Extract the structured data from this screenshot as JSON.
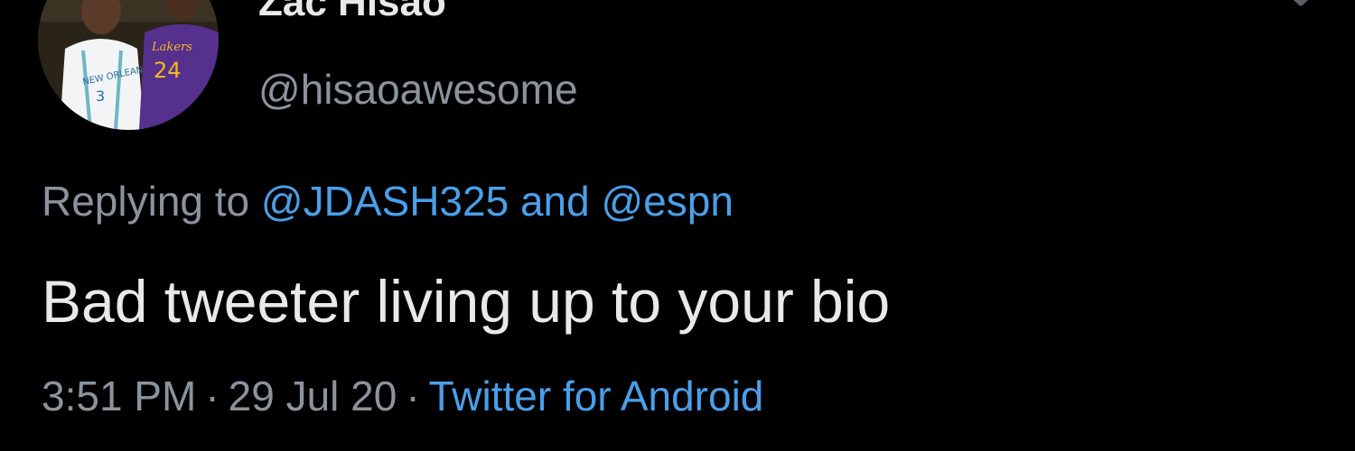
{
  "author": {
    "display_name": "Zac Hisao",
    "handle": "@hisaoawesome",
    "avatar_icon": "profile-photo-basketball-players"
  },
  "header": {
    "menu_icon": "chevron-down-icon"
  },
  "reply": {
    "prefix": "Replying to",
    "mentions": [
      "@JDASH325",
      "@espn"
    ],
    "joiner": "and"
  },
  "tweet": {
    "text": "Bad tweeter living up to your bio"
  },
  "meta": {
    "time": "3:51 PM",
    "date": "29 Jul 20",
    "separator": "·",
    "source": "Twitter for Android"
  },
  "colors": {
    "background": "#000000",
    "primary_text": "#e7e9ea",
    "secondary_text": "#8b949c",
    "link": "#4a9fe8"
  }
}
